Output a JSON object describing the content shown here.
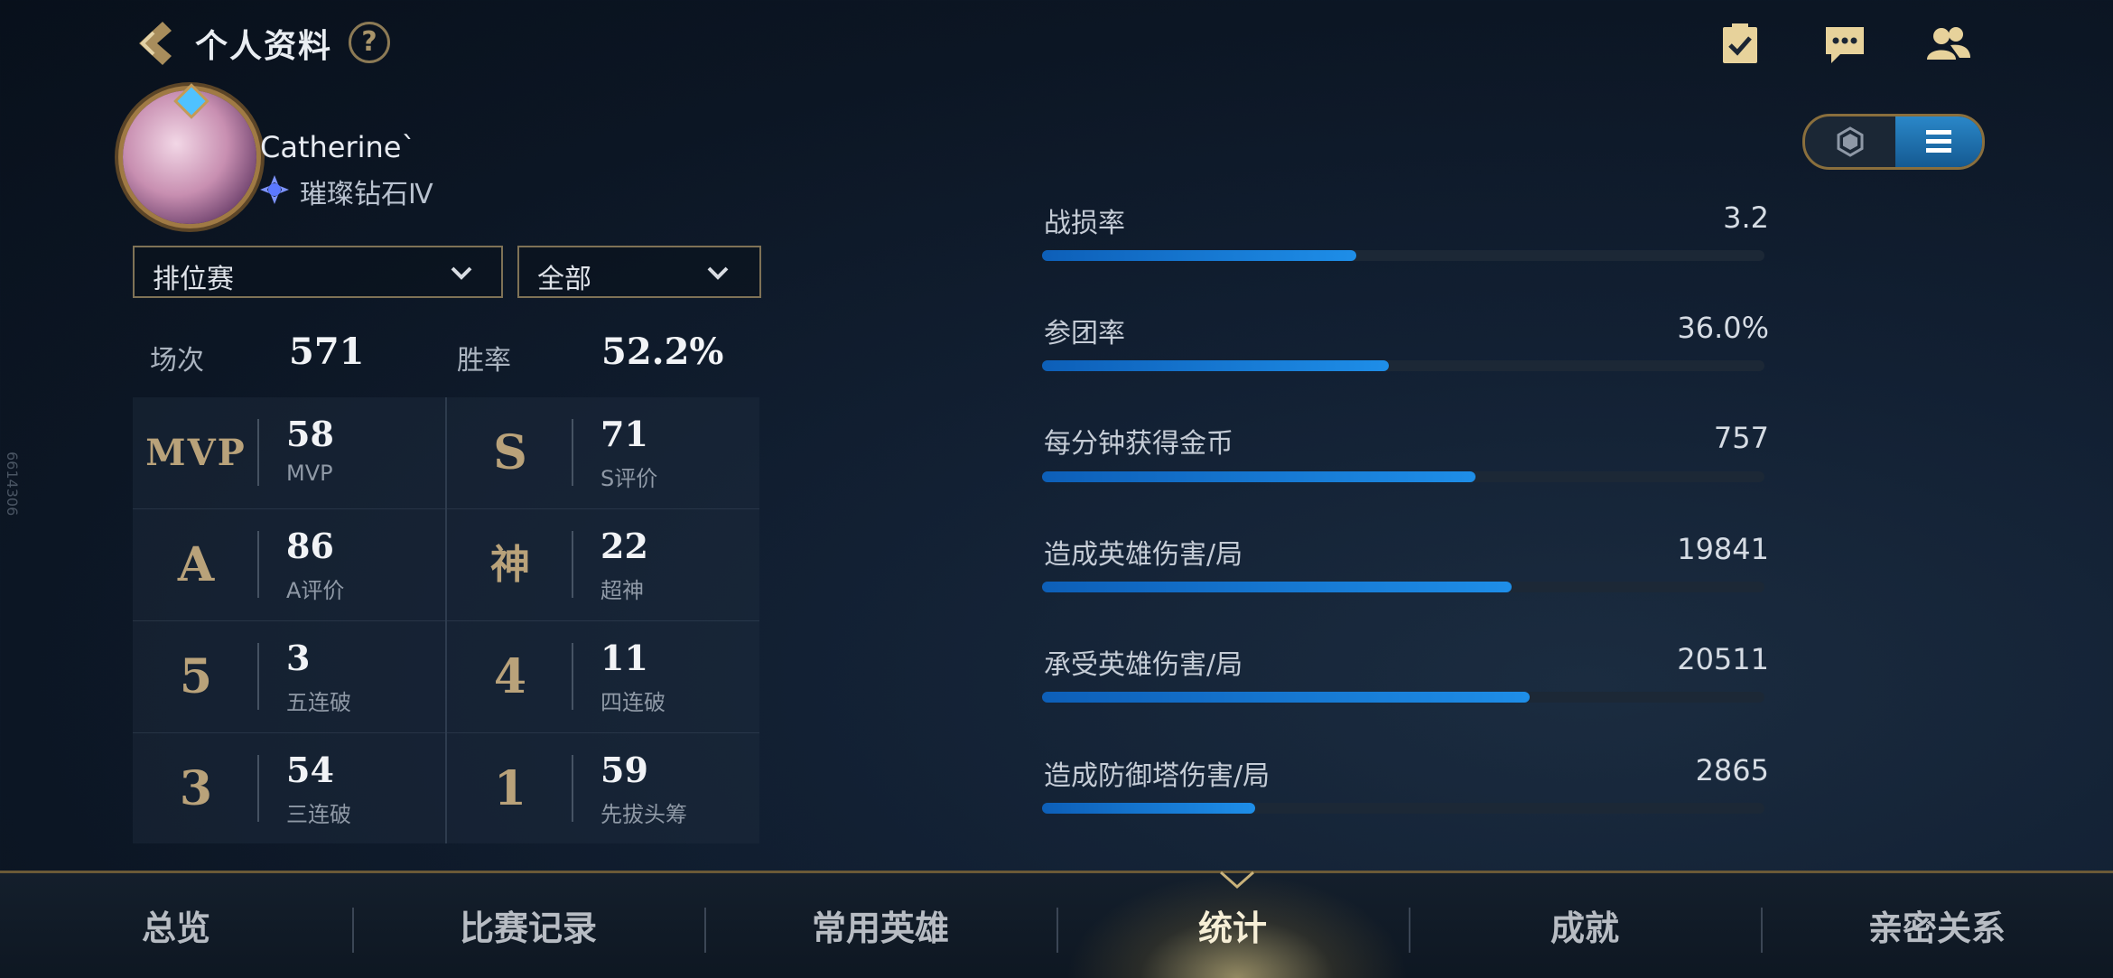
{
  "header": {
    "title": "个人资料",
    "help_label": "?"
  },
  "profile": {
    "username": "Catherine`",
    "rank": "璀璨钻石Ⅳ"
  },
  "filters": {
    "mode": "排位赛",
    "scope": "全部"
  },
  "summary": {
    "games_label": "场次",
    "games_value": "571",
    "winrate_label": "胜率",
    "winrate_value": "52.2%"
  },
  "honors": [
    {
      "icon": "MVP",
      "value": "58",
      "label": "MVP"
    },
    {
      "icon": "S",
      "value": "71",
      "label": "S评价"
    },
    {
      "icon": "A",
      "value": "86",
      "label": "A评价"
    },
    {
      "icon": "神",
      "value": "22",
      "label": "超神"
    },
    {
      "icon": "5",
      "value": "3",
      "label": "五连破"
    },
    {
      "icon": "4",
      "value": "11",
      "label": "四连破"
    },
    {
      "icon": "3",
      "value": "54",
      "label": "三连破"
    },
    {
      "icon": "1",
      "value": "59",
      "label": "先拔头筹"
    }
  ],
  "stats": [
    {
      "label": "战损率",
      "value": "3.2",
      "fill": 0.435
    },
    {
      "label": "参团率",
      "value": "36.0%",
      "fill": 0.48
    },
    {
      "label": "每分钟获得金币",
      "value": "757",
      "fill": 0.6
    },
    {
      "label": "造成英雄伤害/局",
      "value": "19841",
      "fill": 0.65
    },
    {
      "label": "承受英雄伤害/局",
      "value": "20511",
      "fill": 0.675
    },
    {
      "label": "造成防御塔伤害/局",
      "value": "2865",
      "fill": 0.295
    }
  ],
  "nav": {
    "tabs": [
      "总览",
      "比赛记录",
      "常用英雄",
      "统计",
      "成就",
      "亲密关系"
    ],
    "active": "统计"
  },
  "watermark": "6614306",
  "colors": {
    "accent_gold": "#a8946a",
    "bar_blue": "#1e8ee8",
    "toggle_active": "#2a87c8"
  }
}
